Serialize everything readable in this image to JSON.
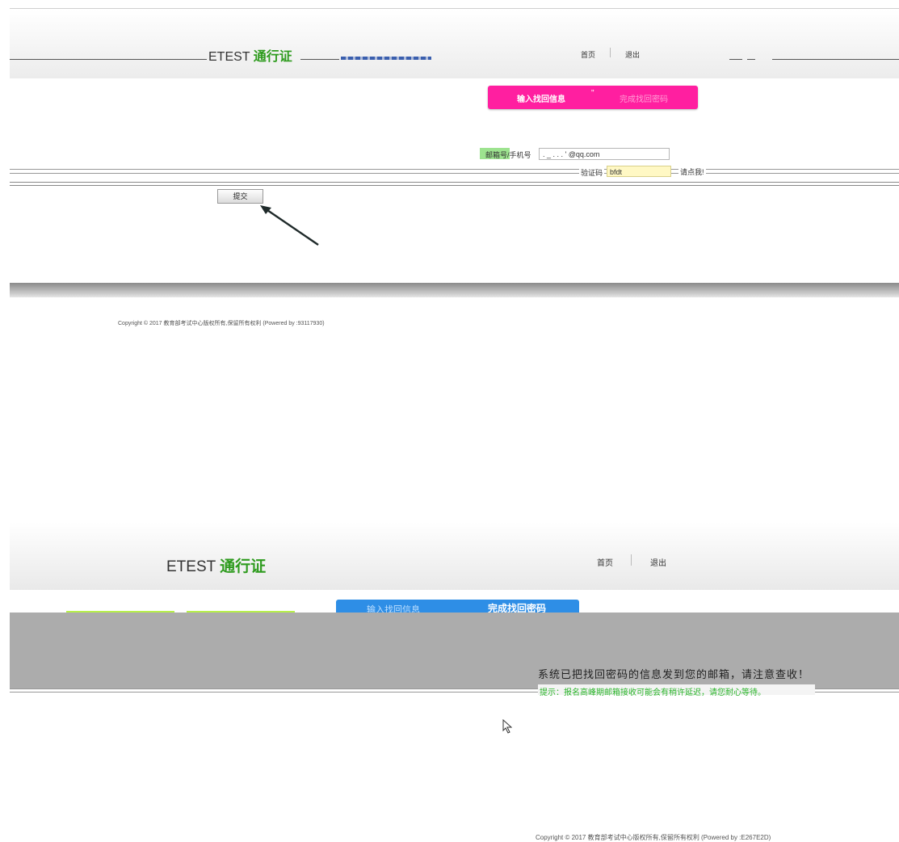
{
  "top": {
    "logo_prefix": "ETEST",
    "logo_accent": "通行证",
    "nav": {
      "home": "首页",
      "logout": "退出"
    },
    "steps": {
      "step1": "输入找回信息",
      "step2": "完成找回密码"
    },
    "form": {
      "account_label": "邮箱号/手机号",
      "account_value": ". _ . . . ' @qq.com",
      "captcha_label": "验证码",
      "captcha_value": "bfdt",
      "refresh_link": "请点我!",
      "submit_label": "提交"
    },
    "copyright": "Copyright © 2017 教育部考试中心版权所有,保留所有权利 (Powered by :93117930)"
  },
  "bottom": {
    "logo_prefix": "ETEST",
    "logo_accent": "通行证",
    "nav": {
      "home": "首页",
      "logout": "退出"
    },
    "steps": {
      "step1": "输入找回信息",
      "step2": "完成找回密码"
    },
    "message": "系统已把找回密码的信息发到您的邮箱，请注意查收！",
    "tip": "提示：报名高峰期邮箱接收可能会有稍许延迟，请您耐心等待。",
    "copyright": "Copyright © 2017 教育部考试中心版权所有,保留所有权利 (Powered by :E267E2D)"
  },
  "colors": {
    "brand_green": "#2e9b1e",
    "step_pink": "#ff1fa0",
    "step_blue": "#2e8ee6",
    "tip_green": "#2bb52b"
  },
  "icons": [
    "arrow-annotation-icon",
    "mouse-cursor-icon"
  ]
}
